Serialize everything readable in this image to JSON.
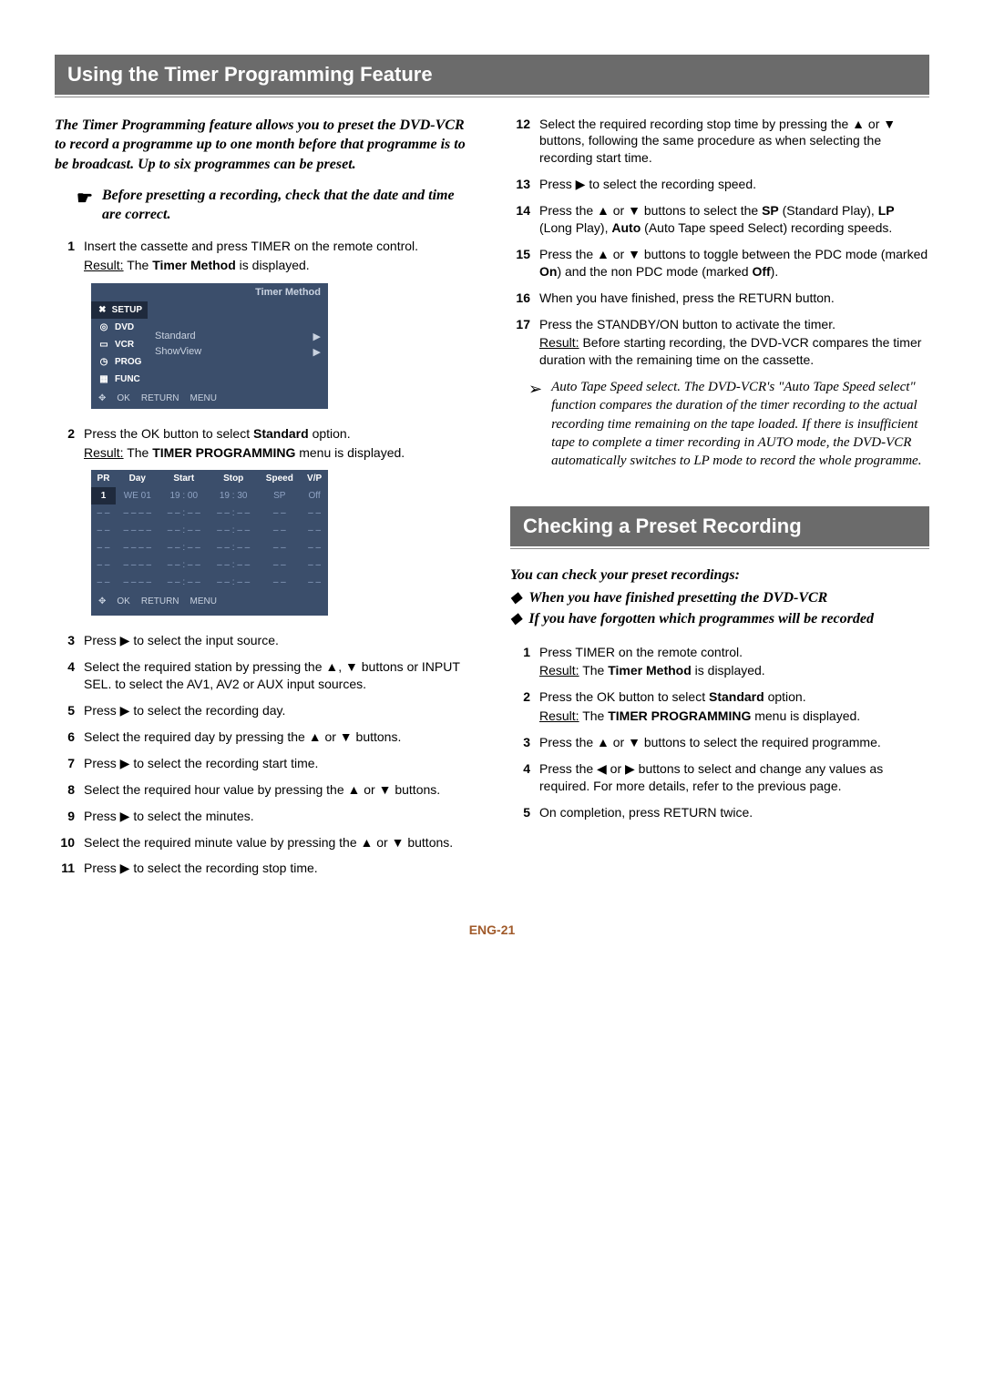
{
  "heading1": "Using the Timer Programming Feature",
  "intro": "The Timer Programming feature allows you to preset the DVD-VCR to record a programme up to one month before that programme is to be broadcast. Up to six programmes can be preset.",
  "pointer_note": "Before presetting a recording, check that the date and time are correct.",
  "left_steps": [
    {
      "n": "1",
      "t": "Insert the cassette and press TIMER on the remote control."
    },
    {
      "n": "",
      "t": ""
    }
  ],
  "step1_result_label": "Result:",
  "step1_result_text_1": "The ",
  "step1_result_bold": "Timer Method",
  "step1_result_text_2": " is displayed.",
  "osd1": {
    "title": "Timer Method",
    "side": [
      "SETUP",
      "DVD",
      "VCR",
      "PROG",
      "FUNC"
    ],
    "opts": [
      "Standard",
      "ShowView"
    ],
    "footer": [
      "OK",
      "RETURN",
      "MENU"
    ]
  },
  "step2_pre": "Press the OK button to select ",
  "step2_bold": "Standard",
  "step2_post": " option.",
  "step2_result_label": "Result:",
  "step2_result_text_1": "The ",
  "step2_result_bold": "TIMER PROGRAMMING",
  "step2_result_text_2": " menu is displayed.",
  "osd2": {
    "headers": [
      "PR",
      "Day",
      "Start",
      "Stop",
      "Speed",
      "V/P"
    ],
    "rows": [
      [
        "1",
        "WE  01",
        "19 : 00",
        "19 : 30",
        "SP",
        "Off"
      ],
      [
        "– –",
        "– –  – –",
        "– – : – –",
        "– – : – –",
        "– –",
        "– –"
      ],
      [
        "– –",
        "– –  – –",
        "– – : – –",
        "– – : – –",
        "– –",
        "– –"
      ],
      [
        "– –",
        "– –  – –",
        "– – : – –",
        "– – : – –",
        "– –",
        "– –"
      ],
      [
        "– –",
        "– –  – –",
        "– – : – –",
        "– – : – –",
        "– –",
        "– –"
      ],
      [
        "– –",
        "– –  – –",
        "– – : – –",
        "– – : – –",
        "– –",
        "– –"
      ]
    ],
    "footer": [
      "OK",
      "RETURN",
      "MENU"
    ]
  },
  "left_list": [
    {
      "n": "3",
      "html": "Press ▶ to select the input source."
    },
    {
      "n": "4",
      "html": "Select the required station by pressing the ▲, ▼ buttons or INPUT SEL. to select the AV1, AV2 or AUX input sources."
    },
    {
      "n": "5",
      "html": "Press ▶ to select the recording day."
    },
    {
      "n": "6",
      "html": "Select the required day by pressing the ▲ or ▼ buttons."
    },
    {
      "n": "7",
      "html": "Press ▶ to select the recording start time."
    },
    {
      "n": "8",
      "html": "Select the required hour value by pressing the ▲ or ▼ buttons."
    },
    {
      "n": "9",
      "html": "Press ▶ to select the minutes."
    },
    {
      "n": "10",
      "html": "Select the required minute value by pressing the ▲ or ▼ buttons."
    },
    {
      "n": "11",
      "html": "Press ▶ to select the recording stop time."
    }
  ],
  "right_top": [
    {
      "n": "12",
      "html": "Select the required recording stop time by pressing the ▲ or ▼ buttons, following the same procedure as when selecting the recording start time."
    },
    {
      "n": "13",
      "html": "Press ▶ to select the recording speed."
    }
  ],
  "step14_pre": "Press the ▲ or ▼ buttons to select the ",
  "step14_sp": "SP",
  "step14_mid1": " (Standard Play), ",
  "step14_lp": "LP",
  "step14_mid2": " (Long Play), ",
  "step14_auto": "Auto",
  "step14_post": " (Auto Tape speed Select) recording speeds.",
  "step15_pre": "Press the ▲ or ▼ buttons to toggle between the PDC mode (marked ",
  "step15_on": "On",
  "step15_mid": ") and the non PDC mode (marked ",
  "step15_off": "Off",
  "step15_post": ").",
  "right_rest": [
    {
      "n": "16",
      "html": "When you have finished, press the RETURN button."
    }
  ],
  "step17_text": "Press the STANDBY/ON button to activate the timer.",
  "step17_result_label": "Result:",
  "step17_result_text": "Before starting recording, the DVD-VCR compares the timer duration with the remaining time on the cassette.",
  "aside": "Auto Tape Speed select. The DVD-VCR's \"Auto Tape Speed select\" function compares the duration of the timer recording to the actual recording time remaining on the tape loaded. If there is insufficient tape to complete a timer recording in AUTO mode, the DVD-VCR automatically switches to LP mode to record the whole programme.",
  "heading2": "Checking a Preset Recording",
  "check_intro": "You can check your preset recordings:",
  "check_bullets": [
    "When you have finished presetting the DVD-VCR",
    "If you have forgotten which programmes will be recorded"
  ],
  "check_steps_simple": [
    {
      "n": "1",
      "pre": "Press TIMER on the remote control.",
      "res_label": "Result:",
      "res_pre": "The ",
      "res_b": "Timer Method",
      "res_post": " is displayed."
    },
    {
      "n": "2",
      "pre": "Press the OK button to select ",
      "pre_b": "Standard",
      "pre_post": " option.",
      "res_label": "Result:",
      "res_pre": "The ",
      "res_b": "TIMER PROGRAMMING",
      "res_post": " menu is displayed."
    }
  ],
  "check_rest": [
    {
      "n": "3",
      "html": "Press the ▲ or ▼ buttons to select the required programme."
    },
    {
      "n": "4",
      "html": "Press the ◀ or ▶ buttons to select and change any values as required. For more details, refer to the previous page."
    },
    {
      "n": "5",
      "html": "On completion, press RETURN twice."
    }
  ],
  "page_num": "ENG-21"
}
